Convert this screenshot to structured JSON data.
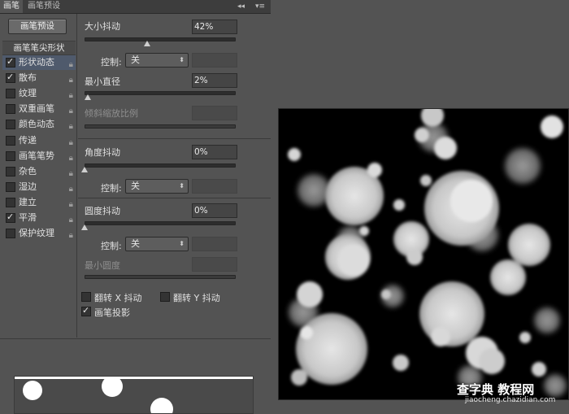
{
  "tabs": {
    "brush": "画笔",
    "brush_presets": "画笔预设",
    "collapse": "◂◂",
    "menu": "▾≡"
  },
  "sidebar": {
    "preset_button": "画笔预设",
    "header": "画笔笔尖形状",
    "items": [
      {
        "label": "形状动态",
        "checked": true,
        "selected": true
      },
      {
        "label": "散布",
        "checked": true,
        "selected": false
      },
      {
        "label": "纹理",
        "checked": false,
        "selected": false
      },
      {
        "label": "双重画笔",
        "checked": false,
        "selected": false
      },
      {
        "label": "颜色动态",
        "checked": false,
        "selected": false
      },
      {
        "label": "传递",
        "checked": false,
        "selected": false
      },
      {
        "label": "画笔笔势",
        "checked": false,
        "selected": false
      },
      {
        "label": "杂色",
        "checked": false,
        "selected": false
      },
      {
        "label": "湿边",
        "checked": false,
        "selected": false
      },
      {
        "label": "建立",
        "checked": false,
        "selected": false
      },
      {
        "label": "平滑",
        "checked": true,
        "selected": false
      },
      {
        "label": "保护纹理",
        "checked": false,
        "selected": false
      }
    ]
  },
  "controls": {
    "size_jitter": {
      "label": "大小抖动",
      "value": "42%",
      "fraction": 0.42
    },
    "size_control": {
      "label": "控制:",
      "value": "关"
    },
    "min_diameter": {
      "label": "最小直径",
      "value": "2%",
      "fraction": 0.02
    },
    "tilt_scale": {
      "label": "倾斜缩放比例"
    },
    "angle_jitter": {
      "label": "角度抖动",
      "value": "0%",
      "fraction": 0.0
    },
    "angle_control": {
      "label": "控制:",
      "value": "关"
    },
    "roundness_jitter": {
      "label": "圆度抖动",
      "value": "0%",
      "fraction": 0.0
    },
    "roundness_control": {
      "label": "控制:",
      "value": "关"
    },
    "min_roundness": {
      "label": "最小圆度"
    },
    "flip_x": {
      "label": "翻转 X 抖动",
      "checked": false
    },
    "flip_y": {
      "label": "翻转 Y 抖动",
      "checked": false
    },
    "brush_projection": {
      "label": "画笔投影",
      "checked": true
    }
  },
  "watermark": {
    "line1": "查字典 教程网",
    "line2": "jiaocheng.chazidian.com"
  },
  "colors": {
    "panel": "#535353",
    "tabbar": "#3d3d3d",
    "selected": "#4f5a6c",
    "canvas": "#000000"
  }
}
